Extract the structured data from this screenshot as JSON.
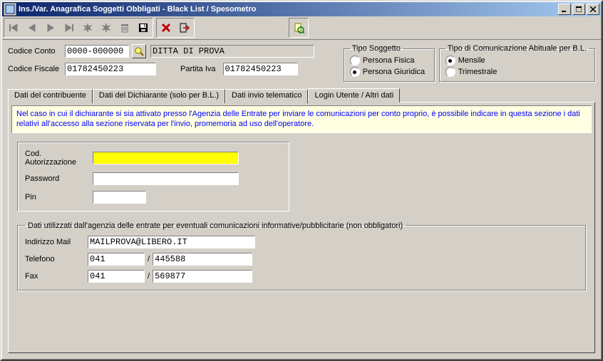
{
  "window": {
    "title": "Ins./Var. Anagrafica Soggetti Obbligati - Black List / Spesometro"
  },
  "header": {
    "codice_conto_label": "Codice Conto",
    "codice_conto_value": "0000-000000",
    "ditta_value": "DITTA DI PROVA",
    "codice_fiscale_label": "Codice Fiscale",
    "codice_fiscale_value": "01782450223",
    "partita_iva_label": "Partita Iva",
    "partita_iva_value": "01782450223"
  },
  "tipo_soggetto": {
    "legend": "Tipo Soggetto",
    "fisica_label": "Persona Fisica",
    "giuridica_label": "Persona Giuridica",
    "selected": "giuridica"
  },
  "tipo_comunicazione": {
    "legend": "Tipo di Comunicazione Abituale per B.L.",
    "mensile_label": "Mensile",
    "trimestrale_label": "Trimestrale",
    "selected": "mensile"
  },
  "tabs": {
    "items": [
      {
        "label": "Dati del contribuente"
      },
      {
        "label": "Dati del Dichiarante (solo per B.L.)"
      },
      {
        "label": "Dati invio telematico"
      },
      {
        "label": "Login Utente / Altri dati"
      }
    ],
    "active_index": 3
  },
  "info_text": "Nel caso in cui il dichiarante si sia attivato presso l'Agenzia delle Entrate per inviare le comunicazioni per conto proprio, è possibile indicare in questa sezione i dati relativi all'accesso alla sezione riservata per l'invio, promemoria ad uso dell'operatore.",
  "login": {
    "cod_aut_label": "Cod. Autorizzazione",
    "cod_aut_value": "",
    "password_label": "Password",
    "password_value": "",
    "pin_label": "Pin",
    "pin_value": ""
  },
  "contact": {
    "legend": "Dati utilizzati dall'agenzia delle entrate per eventuali comunicazioni informative/pubblicitarie (non obbligatori)",
    "mail_label": "Indirizzo Mail",
    "mail_value": "MAILPROVA@LIBERO.IT",
    "telefono_label": "Telefono",
    "telefono_prefix": "041",
    "telefono_value": "445588",
    "fax_label": "Fax",
    "fax_prefix": "041",
    "fax_value": "569877",
    "slash": "/"
  }
}
